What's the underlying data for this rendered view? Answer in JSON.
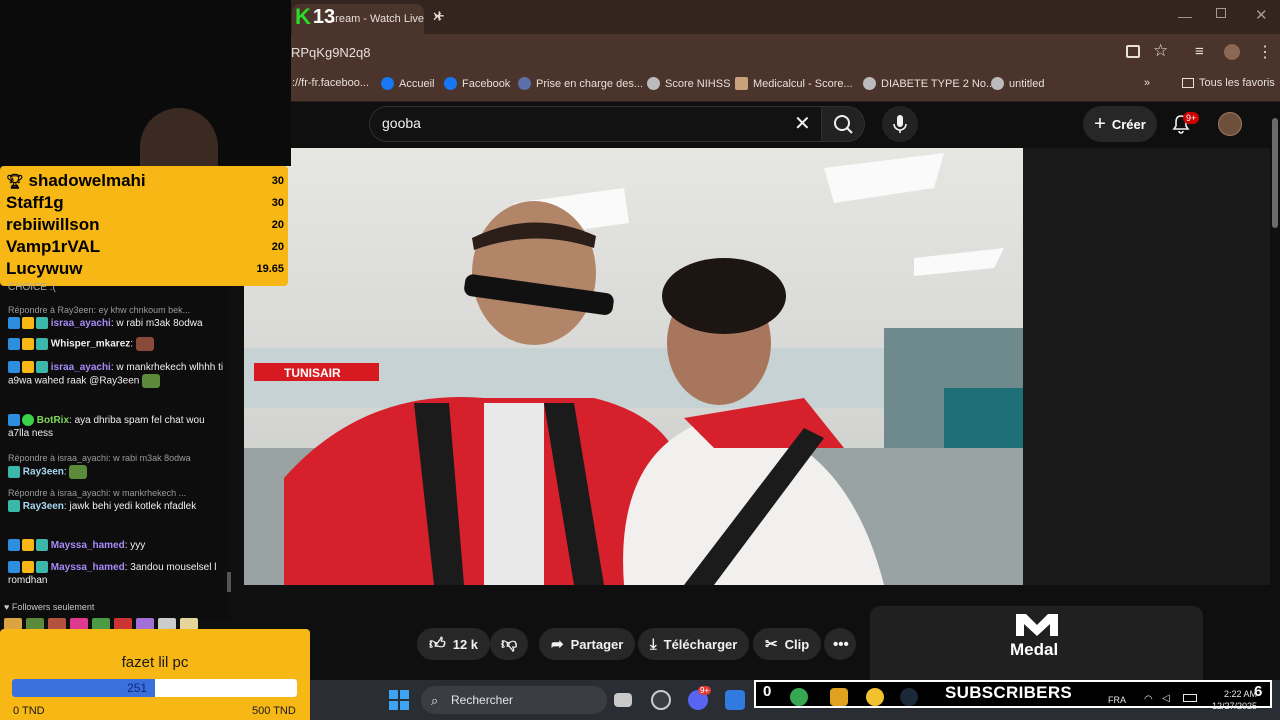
{
  "browser": {
    "tab_title": "...ream - Watch Live on...",
    "url": "RPqKg9N2q8",
    "bookmarks": [
      {
        "label": "://fr-fr.faceboo...",
        "icon": "none"
      },
      {
        "label": "Accueil",
        "icon": "facebook-icon"
      },
      {
        "label": "Facebook",
        "icon": "facebook-icon"
      },
      {
        "label": "Prise en charge des...",
        "icon": "globe-icon"
      },
      {
        "label": "Score NIHSS",
        "icon": "globe-icon"
      },
      {
        "label": "Medicalcul - Score...",
        "icon": "medicalcul-icon"
      },
      {
        "label": "DIABETE TYPE 2 No...",
        "icon": "globe-icon"
      },
      {
        "label": "untitled",
        "icon": "globe-icon"
      }
    ],
    "all_bookmarks": "Tous les favoris",
    "more_bookmarks": "»"
  },
  "stream_overlay": {
    "logo_k": "K",
    "viewer_count": "13",
    "leaderboard": [
      {
        "name": "shadowelmahi",
        "value": "30",
        "trophy": true
      },
      {
        "name": "Staff1g",
        "value": "30"
      },
      {
        "name": "rebiiwillson",
        "value": "20"
      },
      {
        "name": "Vamp1rVAL",
        "value": "20"
      },
      {
        "name": "Lucywuw",
        "value": "19.65"
      }
    ],
    "chat_partial": "CHOICE :(",
    "chat": [
      {
        "reply": "Répondre à Ray3een: ey khw chnkoum bek...",
        "user": "israa_ayachi",
        "color": "#a78bfa",
        "text": ": w rabi m3ak 8odwa"
      },
      {
        "user": "Whisper_mkarez",
        "color": "#ffffff",
        "text": ":"
      },
      {
        "user": "israa_ayachi",
        "color": "#a78bfa",
        "text": ": w mankrhekech wlhhh ti a9wa wahed raak @Ray3een"
      },
      {
        "user": "BotRix",
        "color": "#7dd957",
        "text": ": aya dhriba spam fel chat wou a7lla ness"
      },
      {
        "reply": "Répondre à israa_ayachi: w rabi m3ak 8odwa",
        "user": "Ray3een",
        "color": "#a7d8f0",
        "text": ":"
      },
      {
        "reply": "Répondre à israa_ayachi: w mankrhekech ...",
        "user": "Ray3een",
        "color": "#a7d8f0",
        "text": ": jawk behi yedi kotlek nfadlek"
      },
      {
        "user": "Mayssa_hamed",
        "color": "#a78bfa",
        "text": ": yyy"
      },
      {
        "user": "Mayssa_hamed",
        "color": "#a78bfa",
        "text": ": 3andou mouselsel l romdhan"
      }
    ],
    "followers_only": "Followers seulement",
    "goal": {
      "title": "fazet lil pc",
      "current": "251",
      "min": "0 TND",
      "max": "500 TND",
      "progress": 0.502
    }
  },
  "youtube": {
    "search_query": "gooba",
    "create_label": "Créer",
    "notifications_badge": "9+",
    "actions": {
      "likes": "12 k",
      "share": "Partager",
      "download": "Télécharger",
      "clip": "Clip"
    },
    "ad_brand": "Medal"
  },
  "taskbar": {
    "search_placeholder": "Rechercher",
    "subscribers_label": "SUBSCRIBERS",
    "subscribers_left": "0",
    "subscribers_right": "6",
    "language": "FRA",
    "time": "2:22 AM",
    "date": "12/27/2025",
    "badge": "9+"
  },
  "colors": {
    "accent_yellow": "#f7b714",
    "progress_blue": "#3a6fdc",
    "youtube_red": "#cc0000",
    "chrome_brown": "#4a342b"
  }
}
